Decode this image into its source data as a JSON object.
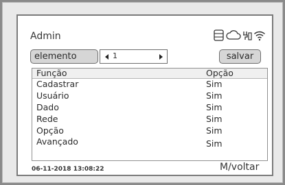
{
  "header": {
    "title": "Admin",
    "icons": [
      "list-icon",
      "cloud-icon",
      "network-icon",
      "wifi-icon"
    ]
  },
  "controls": {
    "element_label": "elemento",
    "stepper_value": "1",
    "save_label": "salvar"
  },
  "table": {
    "columns": [
      "Função",
      "Opção"
    ],
    "rows": [
      [
        "Cadastrar",
        "Sim"
      ],
      [
        "Usuário",
        "Sim"
      ],
      [
        "Dado",
        "Sim"
      ],
      [
        "Rede",
        "Sim"
      ],
      [
        "Opção",
        "Sim"
      ],
      [
        "Avançado",
        "Sim"
      ]
    ]
  },
  "footer": {
    "datetime": "06-11-2018  13:08:22",
    "back_label": "M/voltar"
  }
}
